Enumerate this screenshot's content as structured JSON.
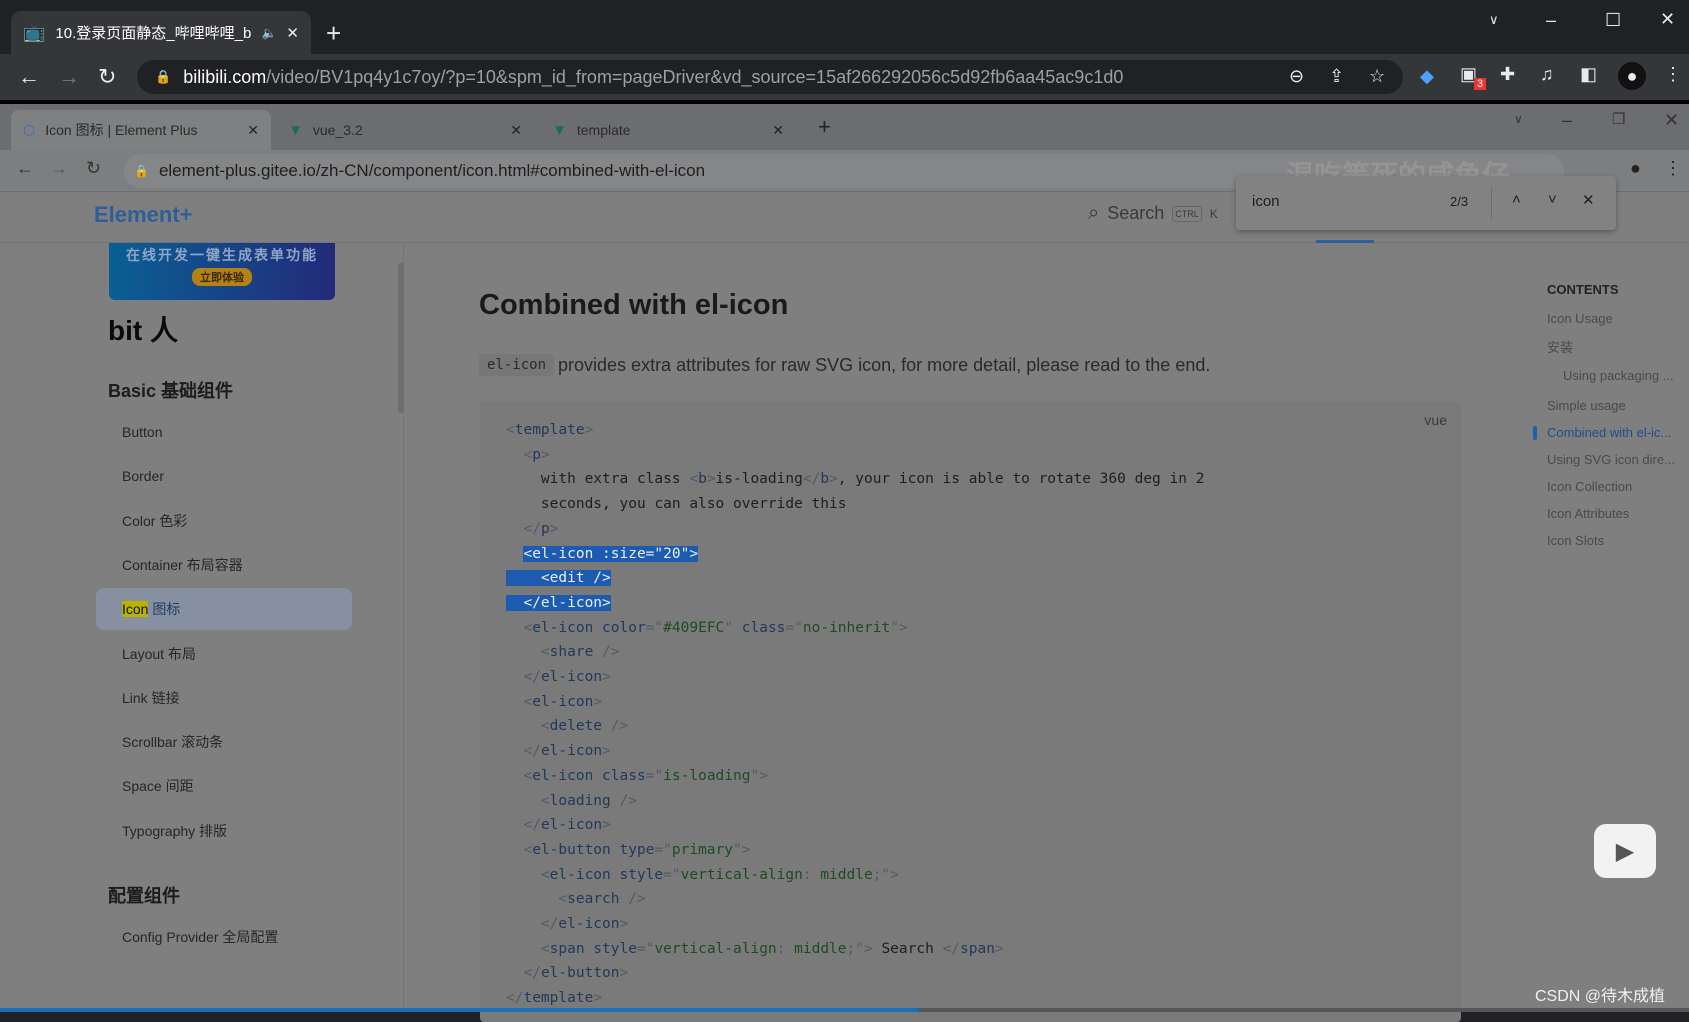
{
  "outer_browser": {
    "tab_title": "10.登录页面静态_哔哩哔哩_b",
    "new_tab": "+",
    "url_host": "bilibili.com",
    "url_path": "/video/BV1pq4y1c7oy/?p=10&spm_id_from=pageDriver&vd_source=15af266292056c5d92fb6aa45ac9c1d0",
    "ext_badge": "3"
  },
  "inner_browser": {
    "tabs": [
      {
        "label": "Icon 图标 | Element Plus",
        "active": true
      },
      {
        "label": "vue_3.2"
      },
      {
        "label": "template"
      }
    ],
    "url": "element-plus.gitee.io/zh-CN/component/icon.html#combined-with-el-icon",
    "watermark": "混吃等死的咸鱼仔"
  },
  "find_bar": {
    "query": "icon",
    "count": "2/3"
  },
  "header": {
    "logo": "Element+",
    "search": "Search",
    "kbd1": "CTRL",
    "kbd2": "K"
  },
  "sidebar": {
    "banner_text": "在线开发一键生成表单功能",
    "banner_button": "立即体验",
    "sponsor": "bit 人",
    "groups": [
      {
        "title": "Basic 基础组件",
        "items": [
          "Button",
          "Border",
          "Color 色彩",
          "Container 布局容器",
          "Icon 图标",
          "Layout 布局",
          "Link 链接",
          "Scrollbar 滚动条",
          "Space 间距",
          "Typography 排版"
        ]
      },
      {
        "title": "配置组件",
        "items": [
          "Config Provider 全局配置"
        ]
      }
    ],
    "active_item": "Icon 图标",
    "highlight": "Icon"
  },
  "main": {
    "title": "Combined with el-icon",
    "desc_code": "el-icon",
    "desc": " provides extra attributes for raw SVG icon, for more detail, please read to the end.",
    "lang": "vue",
    "code": [
      {
        "t": [
          [
            "punc",
            "<"
          ],
          [
            "tag",
            "template"
          ],
          [
            "punc",
            ">"
          ]
        ]
      },
      {
        "t": [
          [
            "txt",
            "  "
          ],
          [
            "punc",
            "<"
          ],
          [
            "tag",
            "p"
          ],
          [
            "punc",
            ">"
          ]
        ]
      },
      {
        "t": [
          [
            "txt",
            "    with extra class "
          ],
          [
            "punc",
            "<"
          ],
          [
            "tag",
            "b"
          ],
          [
            "punc",
            ">"
          ],
          [
            "txt",
            "is-loading"
          ],
          [
            "punc",
            "</"
          ],
          [
            "tag",
            "b"
          ],
          [
            "punc",
            ">"
          ],
          [
            "txt",
            ", your icon is able to rotate 360 deg in 2"
          ]
        ]
      },
      {
        "t": [
          [
            "txt",
            "    seconds, you can also override this"
          ]
        ]
      },
      {
        "t": [
          [
            "txt",
            "  "
          ],
          [
            "punc",
            "</"
          ],
          [
            "tag",
            "p"
          ],
          [
            "punc",
            ">"
          ]
        ]
      },
      {
        "sel": true,
        "first": true,
        "t": [
          [
            "txt",
            "  "
          ],
          [
            "tag",
            "<el-icon :size=\"20\">"
          ]
        ]
      },
      {
        "sel": true,
        "t": [
          [
            "tag",
            "    <edit />"
          ]
        ]
      },
      {
        "sel": true,
        "t": [
          [
            "tag",
            "  </el-icon>"
          ]
        ]
      },
      {
        "t": [
          [
            "txt",
            "  "
          ],
          [
            "punc",
            "<"
          ],
          [
            "tag",
            "el-icon color"
          ],
          [
            "punc",
            "=\""
          ],
          [
            "str",
            "#409EFC"
          ],
          [
            "punc",
            "\" "
          ],
          [
            "tag",
            "class"
          ],
          [
            "punc",
            "=\""
          ],
          [
            "str",
            "no-inherit"
          ],
          [
            "punc",
            "\">"
          ]
        ]
      },
      {
        "t": [
          [
            "txt",
            "    "
          ],
          [
            "punc",
            "<"
          ],
          [
            "tag",
            "share "
          ],
          [
            "punc",
            "/>"
          ]
        ]
      },
      {
        "t": [
          [
            "txt",
            "  "
          ],
          [
            "punc",
            "</"
          ],
          [
            "tag",
            "el-icon"
          ],
          [
            "punc",
            ">"
          ]
        ]
      },
      {
        "t": [
          [
            "txt",
            "  "
          ],
          [
            "punc",
            "<"
          ],
          [
            "tag",
            "el-icon"
          ],
          [
            "punc",
            ">"
          ]
        ]
      },
      {
        "t": [
          [
            "txt",
            "    "
          ],
          [
            "punc",
            "<"
          ],
          [
            "tag",
            "delete "
          ],
          [
            "punc",
            "/>"
          ]
        ]
      },
      {
        "t": [
          [
            "txt",
            "  "
          ],
          [
            "punc",
            "</"
          ],
          [
            "tag",
            "el-icon"
          ],
          [
            "punc",
            ">"
          ]
        ]
      },
      {
        "t": [
          [
            "txt",
            "  "
          ],
          [
            "punc",
            "<"
          ],
          [
            "tag",
            "el-icon class"
          ],
          [
            "punc",
            "=\""
          ],
          [
            "str",
            "is-loading"
          ],
          [
            "punc",
            "\">"
          ]
        ]
      },
      {
        "t": [
          [
            "txt",
            "    "
          ],
          [
            "punc",
            "<"
          ],
          [
            "tag",
            "loading "
          ],
          [
            "punc",
            "/>"
          ]
        ]
      },
      {
        "t": [
          [
            "txt",
            "  "
          ],
          [
            "punc",
            "</"
          ],
          [
            "tag",
            "el-icon"
          ],
          [
            "punc",
            ">"
          ]
        ]
      },
      {
        "t": [
          [
            "txt",
            "  "
          ],
          [
            "punc",
            "<"
          ],
          [
            "tag",
            "el-button type"
          ],
          [
            "punc",
            "=\""
          ],
          [
            "str",
            "primary"
          ],
          [
            "punc",
            "\">"
          ]
        ]
      },
      {
        "t": [
          [
            "txt",
            "    "
          ],
          [
            "punc",
            "<"
          ],
          [
            "tag",
            "el-icon style"
          ],
          [
            "punc",
            "=\""
          ],
          [
            "str",
            "vertical-align"
          ],
          [
            "punc",
            ": "
          ],
          [
            "str",
            "middle"
          ],
          [
            "punc",
            ";\">"
          ]
        ]
      },
      {
        "t": [
          [
            "txt",
            "      "
          ],
          [
            "punc",
            "<"
          ],
          [
            "tag",
            "search "
          ],
          [
            "punc",
            "/>"
          ]
        ]
      },
      {
        "t": [
          [
            "txt",
            "    "
          ],
          [
            "punc",
            "</"
          ],
          [
            "tag",
            "el-icon"
          ],
          [
            "punc",
            ">"
          ]
        ]
      },
      {
        "t": [
          [
            "txt",
            "    "
          ],
          [
            "punc",
            "<"
          ],
          [
            "tag",
            "span style"
          ],
          [
            "punc",
            "=\""
          ],
          [
            "str",
            "vertical-align"
          ],
          [
            "punc",
            ": "
          ],
          [
            "str",
            "middle"
          ],
          [
            "punc",
            ";\">"
          ],
          [
            "txt",
            " Search "
          ],
          [
            "punc",
            "</"
          ],
          [
            "tag",
            "span"
          ],
          [
            "punc",
            ">"
          ]
        ]
      },
      {
        "t": [
          [
            "txt",
            "  "
          ],
          [
            "punc",
            "</"
          ],
          [
            "tag",
            "el-button"
          ],
          [
            "punc",
            ">"
          ]
        ]
      },
      {
        "t": [
          [
            "punc",
            "</"
          ],
          [
            "tag",
            "template"
          ],
          [
            "punc",
            ">"
          ]
        ]
      }
    ]
  },
  "toc": {
    "title": "CONTENTS",
    "items": [
      {
        "label": "Icon Usage"
      },
      {
        "label": "安装"
      },
      {
        "label": "Using packaging ...",
        "sub": true
      },
      {
        "label": "Simple usage"
      },
      {
        "label": "Combined with el-ic...",
        "active": true
      },
      {
        "label": "Using SVG icon dire..."
      },
      {
        "label": "Icon Collection"
      },
      {
        "label": "Icon Attributes"
      },
      {
        "label": "Icon Slots"
      }
    ]
  },
  "watermark": "CSDN @待木成植",
  "video_progress": 0.544,
  "colors": {
    "accent": "#409eff",
    "selection": "#1d5bb0",
    "outer_bg": "#202124"
  }
}
